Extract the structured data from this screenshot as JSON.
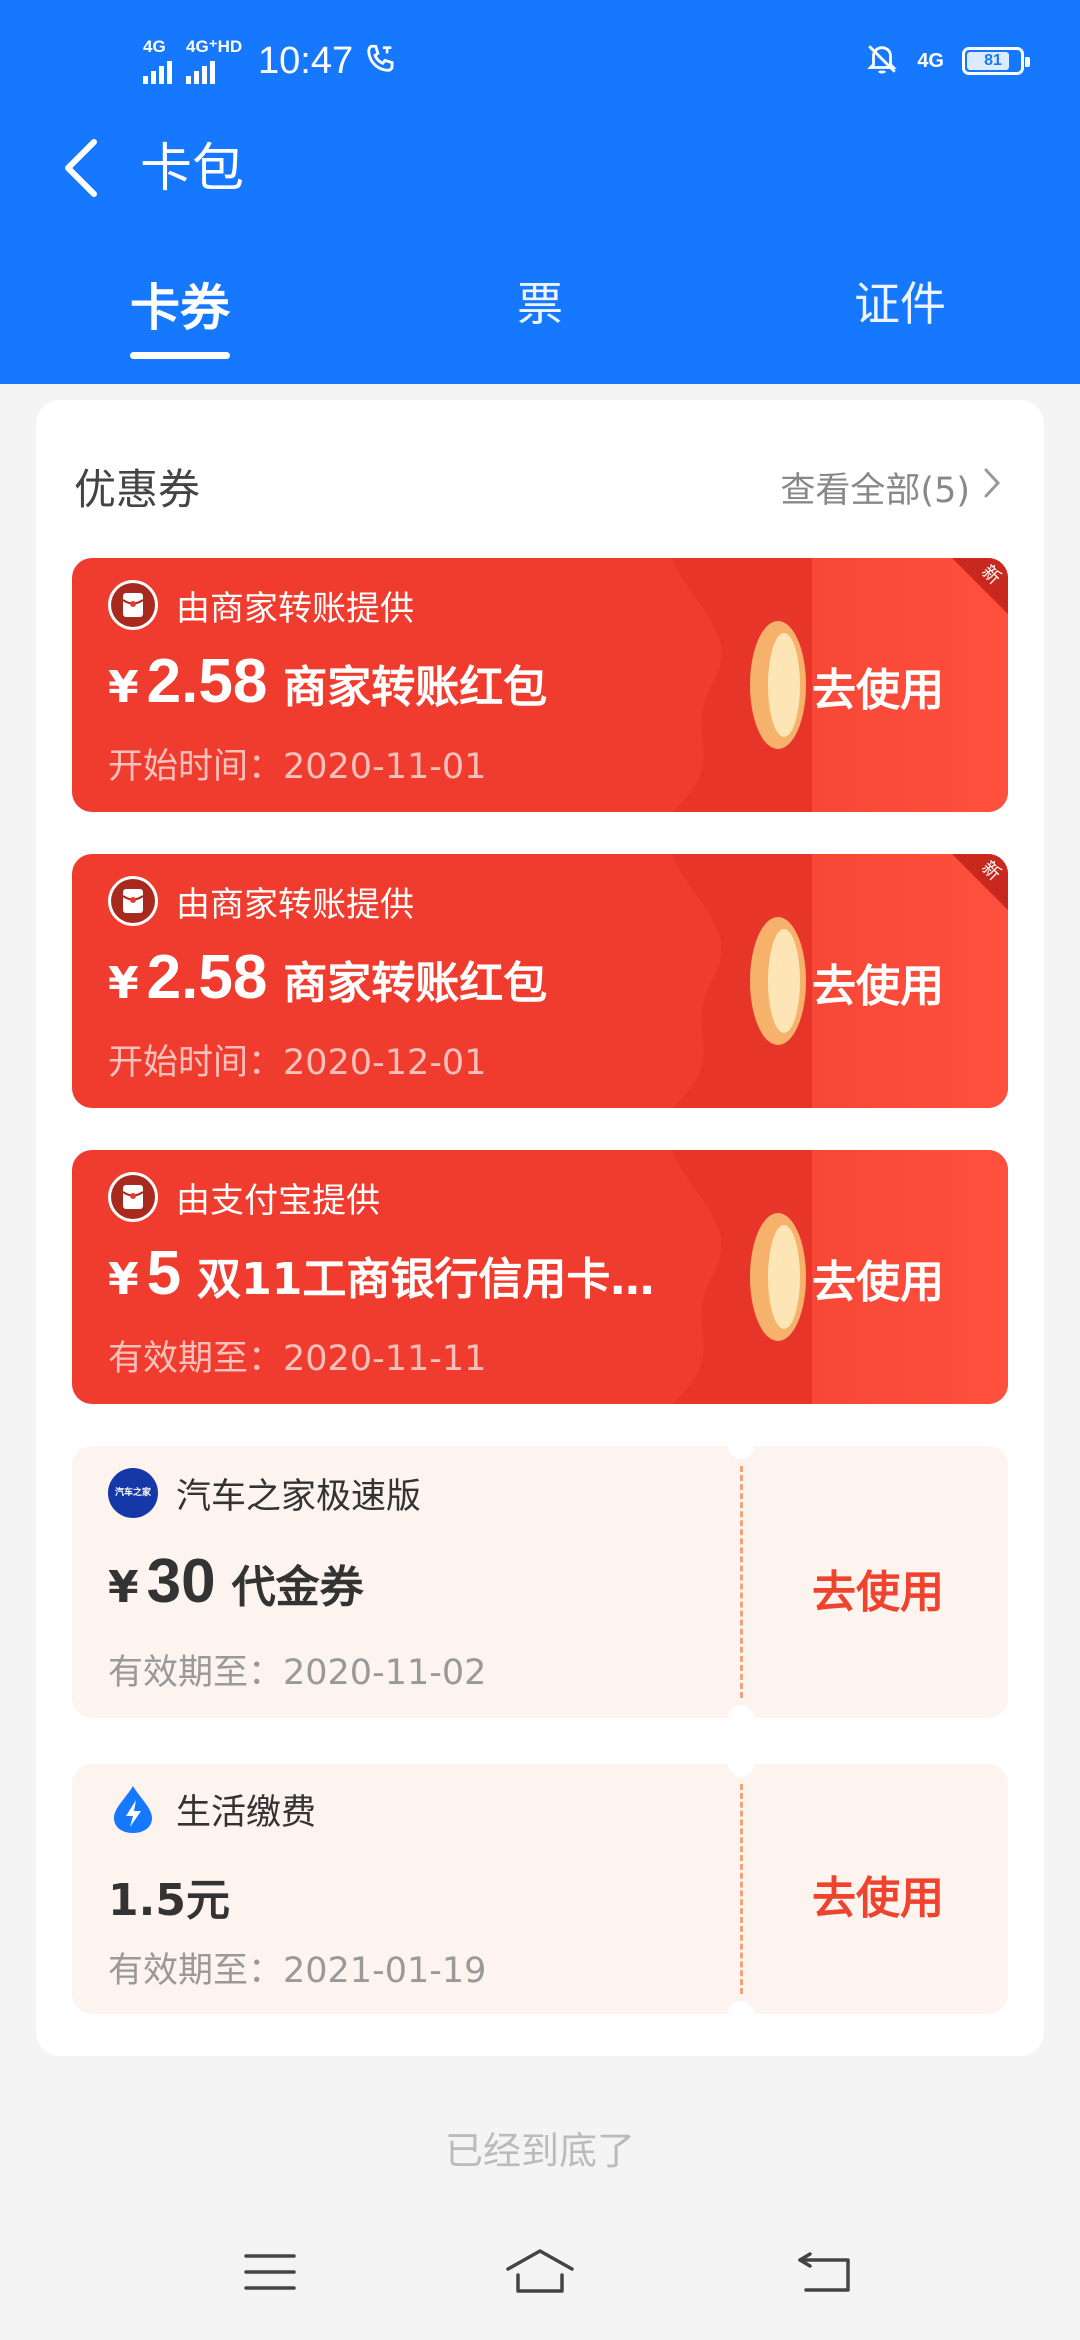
{
  "status_bar": {
    "signal1_label": "4G",
    "signal2_label": "4G⁺HD",
    "time": "10:47",
    "network_label": "4G",
    "battery": "81",
    "battery_level": 0.81
  },
  "header": {
    "title": "卡包",
    "tabs": [
      {
        "label": "卡券",
        "active": true
      },
      {
        "label": "票",
        "active": false
      },
      {
        "label": "证件",
        "active": false
      }
    ]
  },
  "section": {
    "title": "优惠券",
    "view_all": "查看全部(5)"
  },
  "coupons": [
    {
      "style": "red",
      "provider": "由商家转账提供",
      "currency": "¥",
      "amount": "2.58",
      "name": "商家转账红包",
      "date": "开始时间：2020-11-01",
      "action": "去使用",
      "badge": "新"
    },
    {
      "style": "red",
      "provider": "由商家转账提供",
      "currency": "¥",
      "amount": "2.58",
      "name": "商家转账红包",
      "date": "开始时间：2020-12-01",
      "action": "去使用",
      "badge": "新"
    },
    {
      "style": "red",
      "provider": "由支付宝提供",
      "currency": "¥",
      "amount": "5",
      "name": "双11工商银行信用卡…",
      "date": "有效期至：2020-11-11",
      "action": "去使用"
    },
    {
      "style": "light",
      "provider": "汽车之家极速版",
      "provider_logo_text": "汽车之家",
      "currency": "¥",
      "amount": "30",
      "name": "代金券",
      "date": "有效期至：2020-11-02",
      "action": "去使用"
    },
    {
      "style": "light",
      "provider": "生活缴费",
      "amount_text": "1.5元",
      "date": "有效期至：2021-01-19",
      "action": "去使用"
    }
  ],
  "footer_text": "已经到底了",
  "icons": {
    "back": "chevron-left-icon",
    "view_all_arrow": "chevron-right-icon",
    "red_packet": "red-packet-icon",
    "water_drop": "lightning-drop-icon",
    "menu": "menu-icon",
    "home": "home-icon",
    "back_nav": "return-icon"
  },
  "colors": {
    "brand_blue": "#1677ff",
    "coupon_red": "#f03c2e",
    "coupon_light_bg": "#fdf3ef",
    "action_red": "#f0432e"
  }
}
